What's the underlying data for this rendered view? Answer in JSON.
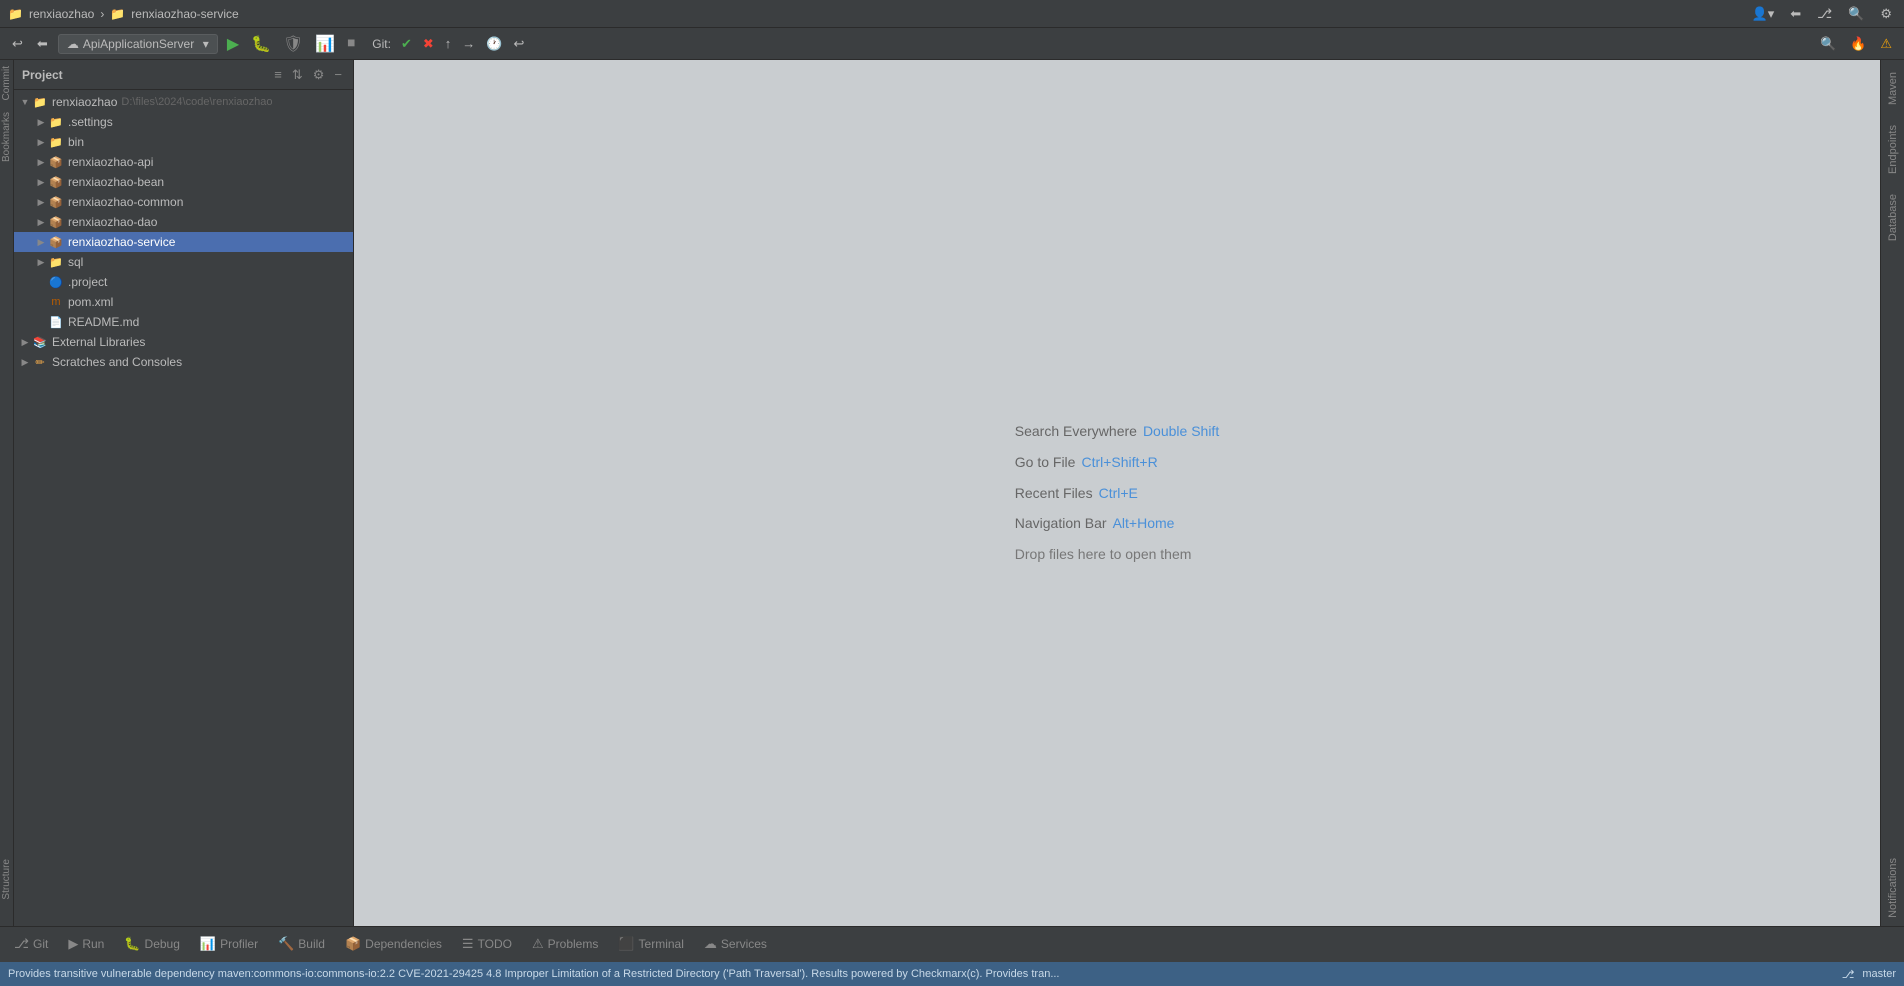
{
  "title_bar": {
    "project_name": "renxiaozhao",
    "separator": "›",
    "service_name": "renxiaozhao-service",
    "folder_icon": "📁",
    "service_icon": "📁"
  },
  "toolbar": {
    "run_config": "ApiApplicationServer",
    "git_label": "Git:",
    "run_icon": "▶",
    "debug_icon": "🐛",
    "build_icon": "🔨",
    "profile_icon": "📊",
    "search_icon": "🔍",
    "undo_icon": "↩",
    "redo_icon": "↪",
    "clock_icon": "🕐",
    "fire_icon": "🔥",
    "warning_icon": "⚠"
  },
  "sidebar": {
    "title": "Project",
    "root": {
      "name": "renxiaozhao",
      "path": "D:\\files\\2024\\code\\renxiaozhao"
    },
    "items": [
      {
        "label": ".settings",
        "type": "folder",
        "level": 2,
        "expanded": false
      },
      {
        "label": "bin",
        "type": "folder",
        "level": 2,
        "expanded": false
      },
      {
        "label": "renxiaozhao-api",
        "type": "module",
        "level": 2,
        "expanded": false
      },
      {
        "label": "renxiaozhao-bean",
        "type": "module",
        "level": 2,
        "expanded": false
      },
      {
        "label": "renxiaozhao-common",
        "type": "module",
        "level": 2,
        "expanded": false
      },
      {
        "label": "renxiaozhao-dao",
        "type": "module",
        "level": 2,
        "expanded": false
      },
      {
        "label": "renxiaozhao-service",
        "type": "module",
        "level": 2,
        "expanded": false,
        "selected": true
      },
      {
        "label": "sql",
        "type": "folder",
        "level": 2,
        "expanded": false
      },
      {
        "label": ".project",
        "type": "eclipse",
        "level": 2
      },
      {
        "label": "pom.xml",
        "type": "maven",
        "level": 2
      },
      {
        "label": "README.md",
        "type": "markdown",
        "level": 2
      }
    ],
    "external_libraries": "External Libraries",
    "scratches": "Scratches and Consoles"
  },
  "welcome": {
    "search_label": "Search Everywhere",
    "search_key": "Double Shift",
    "goto_label": "Go to File",
    "goto_key": "Ctrl+Shift+R",
    "recent_label": "Recent Files",
    "recent_key": "Ctrl+E",
    "nav_label": "Navigation Bar",
    "nav_key": "Alt+Home",
    "drop_text": "Drop files here to open them"
  },
  "right_panel": {
    "tabs": [
      "Maven",
      "Endpoints",
      "Database",
      "Notifications"
    ]
  },
  "bottom_tabs": [
    {
      "label": "Git",
      "icon": "⎇",
      "active": false
    },
    {
      "label": "Run",
      "icon": "▶",
      "active": false
    },
    {
      "label": "Debug",
      "icon": "🐛",
      "active": false
    },
    {
      "label": "Profiler",
      "icon": "📊",
      "active": false
    },
    {
      "label": "Build",
      "icon": "🔨",
      "active": false
    },
    {
      "label": "Dependencies",
      "icon": "📦",
      "active": false
    },
    {
      "label": "TODO",
      "icon": "☰",
      "active": false
    },
    {
      "label": "Problems",
      "icon": "⚠",
      "active": false
    },
    {
      "label": "Terminal",
      "icon": "⬛",
      "active": false
    },
    {
      "label": "Services",
      "icon": "☁",
      "active": false
    }
  ],
  "status_bar": {
    "message": "Provides transitive vulnerable dependency maven:commons-io:commons-io:2.2 CVE-2021-29425 4.8 Improper Limitation of a Restricted Directory ('Path Traversal'). Results powered by Checkmarx(c). Provides tran...",
    "branch": "master"
  },
  "left_vertical": {
    "labels": [
      "Commit",
      "Bookmarks",
      "Structure"
    ]
  }
}
